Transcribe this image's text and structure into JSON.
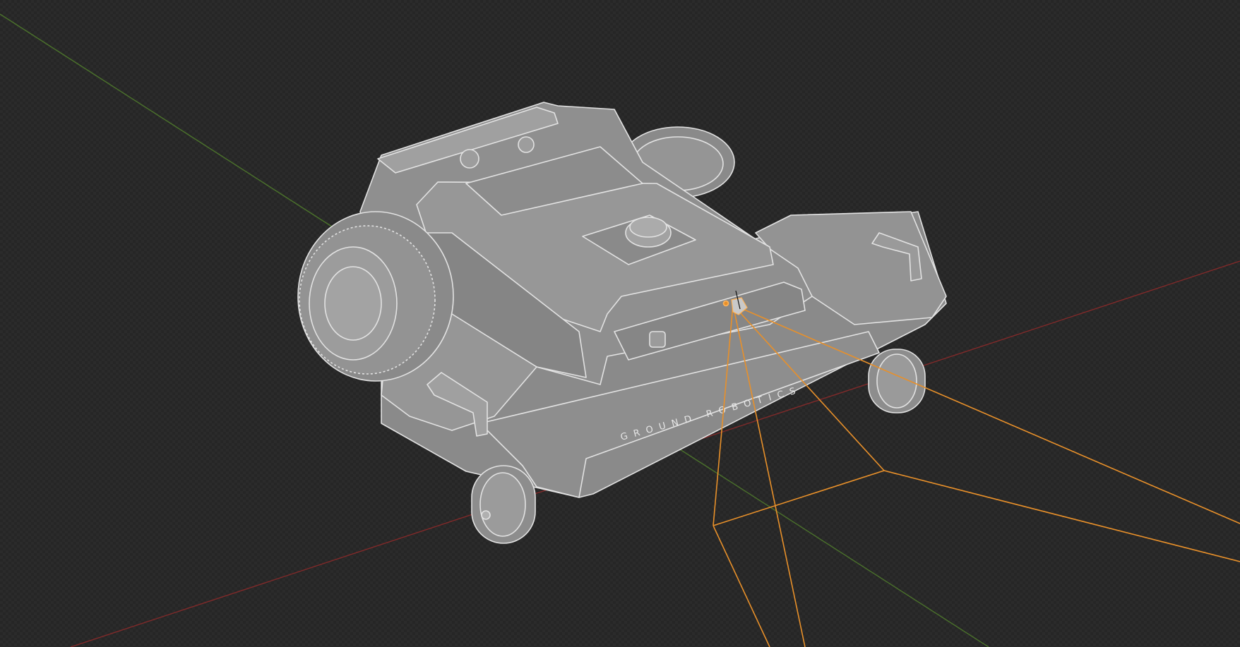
{
  "viewport": {
    "background": "#262626",
    "axis_x_color": "#8b2a2a",
    "axis_y_color": "#4f7a2c",
    "selection_color": "#e8902a"
  },
  "model": {
    "name": "robot-mower",
    "brand_text": "GROUND ROBOTICS",
    "body_fill": "#8e8e8e",
    "edge_color": "#e2e2e2"
  },
  "camera": {
    "selected": true
  }
}
